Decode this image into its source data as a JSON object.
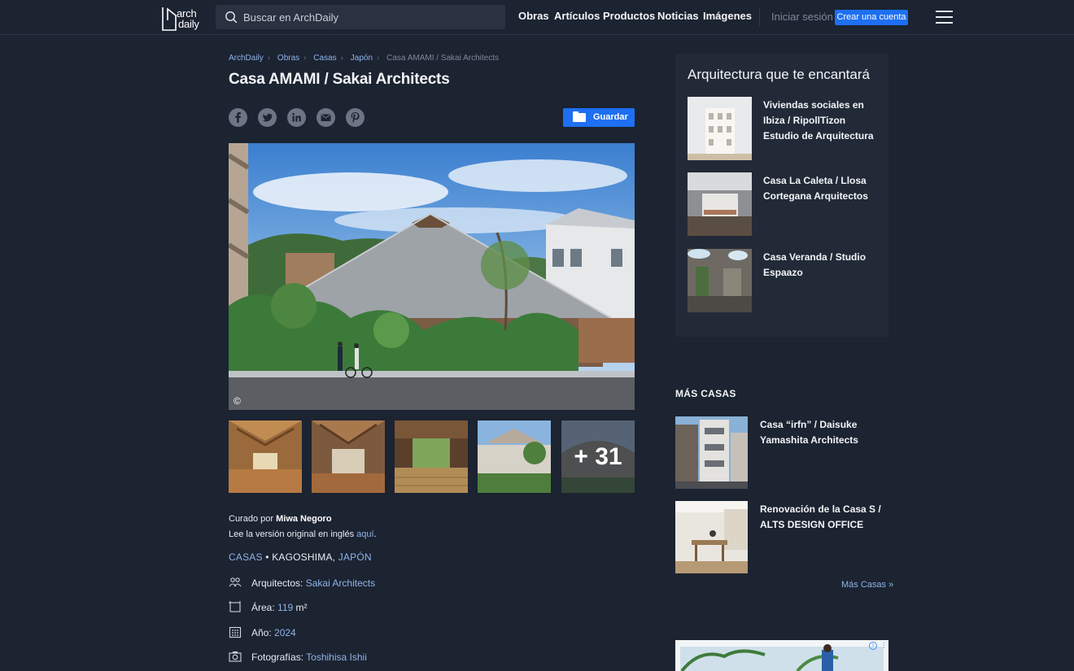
{
  "brand": {
    "logo_line1": "arch",
    "logo_line2": "daily"
  },
  "search": {
    "placeholder": "Buscar en ArchDaily"
  },
  "nav": [
    "Obras",
    "Artículos",
    "Productos",
    "Noticias",
    "Imágenes"
  ],
  "account": {
    "login": "Iniciar sesión",
    "signup": "Crear una cuenta"
  },
  "breadcrumb": [
    "ArchDaily",
    "Obras",
    "Casas",
    "Japón",
    "Casa AMAMI / Sakai Architects"
  ],
  "article": {
    "title": "Casa AMAMI / Sakai Architects",
    "share_icons": [
      "facebook-icon",
      "twitter-icon",
      "linkedin-icon",
      "mail-icon",
      "pinterest-icon"
    ],
    "save_label": "Guardar",
    "copyright_symbol": "©",
    "more_photos": "+ 31",
    "curated_prefix": "Curado por",
    "curator": "Miwa Negoro",
    "original_text": "Lee la versión original en inglés",
    "original_link": "aquí",
    "original_suffix": ".",
    "category": "CASAS",
    "location_city": "KAGOSHIMA,",
    "location_country": "JAPÓN",
    "location_sep": "•",
    "specs": [
      {
        "label": "Arquitectos:",
        "value": "Sakai Architects",
        "unit": "",
        "icon": "people-icon"
      },
      {
        "label": "Área:",
        "value": "119",
        "unit": "m²",
        "icon": "area-icon"
      },
      {
        "label": "Año:",
        "value": "2024",
        "unit": "",
        "icon": "calendar-icon"
      },
      {
        "label": "Fotografías:",
        "value": "Toshihisa Ishii",
        "unit": "",
        "icon": "camera-icon"
      }
    ]
  },
  "sidebar": {
    "heading": "Arquitectura que te encantará",
    "items": [
      "Viviendas sociales en Ibiza / RipollTizon Estudio de Arquitectura",
      "Casa La Caleta / Llosa Cortegana Arquitectos",
      "Casa Veranda / Studio Espaazo"
    ],
    "more_heading": "MÁS CASAS",
    "more_items": [
      "Casa “irfn” / Daisuke Yamashita Architects",
      "Renovación de la Casa S / ALTS DESIGN OFFICE"
    ],
    "more_link": "Más Casas »"
  },
  "colors": {
    "background": "#1c2331",
    "accent": "#1e6ff2",
    "link": "#8fb4e8",
    "card": "#222a38"
  }
}
